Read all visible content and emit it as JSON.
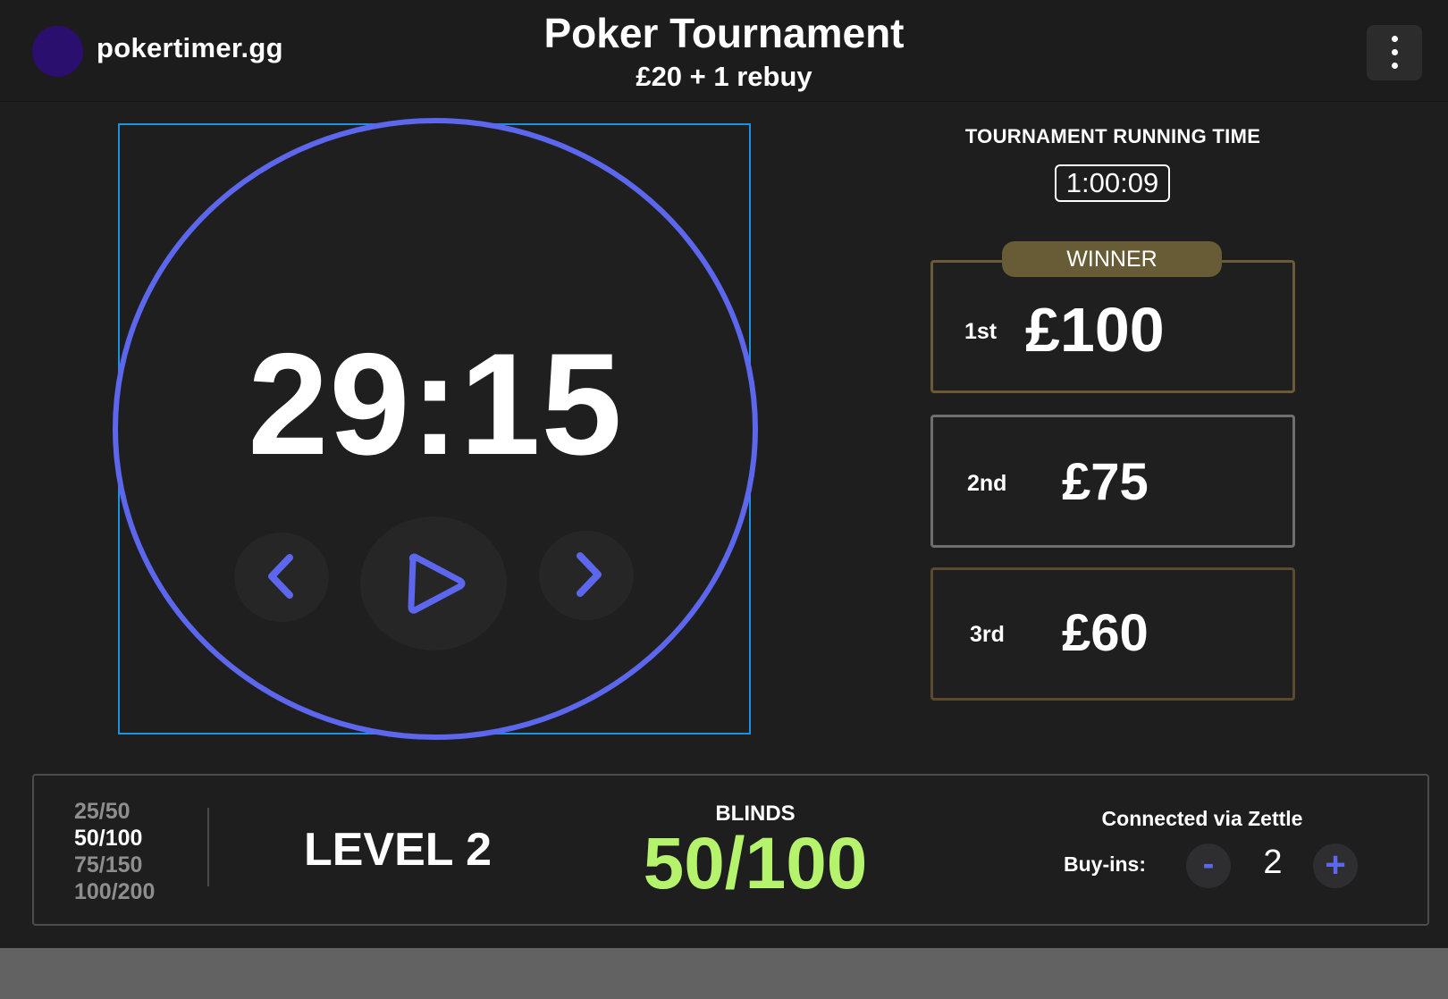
{
  "header": {
    "brand": "pokertimer.gg",
    "title": "Poker Tournament",
    "subtitle": "£20 + 1 rebuy",
    "menu_icon": "more-vertical-icon"
  },
  "timer": {
    "display": "29:15",
    "prev_icon": "chevron-left-icon",
    "play_icon": "play-icon",
    "next_icon": "chevron-right-icon"
  },
  "running_time": {
    "label": "TOURNAMENT RUNNING TIME",
    "value": "1:00:09"
  },
  "prizes": {
    "winner_badge": "WINNER",
    "items": [
      {
        "place": "1st",
        "amount": "£100"
      },
      {
        "place": "2nd",
        "amount": "£75"
      },
      {
        "place": "3rd",
        "amount": "£60"
      }
    ]
  },
  "levels": {
    "list": [
      "25/50",
      "50/100",
      "75/150",
      "100/200"
    ],
    "current_label": "LEVEL 2"
  },
  "blinds": {
    "label": "BLINDS",
    "value": "50/100"
  },
  "buyins": {
    "connection": "Connected via Zettle",
    "label": "Buy-ins:",
    "minus": "-",
    "count": "2",
    "plus": "+"
  },
  "colors": {
    "accent": "#5c67ee",
    "blinds_green": "#b6f36c",
    "winner_gold": "#675c35",
    "frame_blue": "#1e90e0"
  }
}
